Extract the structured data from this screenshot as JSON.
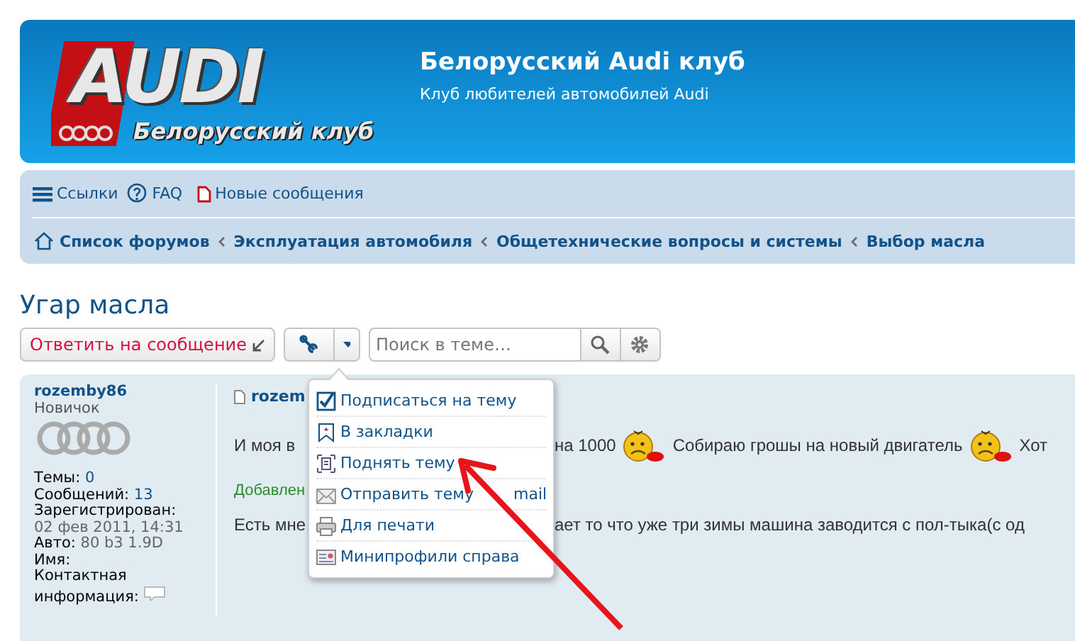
{
  "header": {
    "logo": {
      "word": "AUDI",
      "tagline": "Белорусский клуб"
    },
    "title": "Белорусский Audi клуб",
    "subtitle": "Клуб любителей автомобилей Audi"
  },
  "navbar": {
    "links": [
      {
        "kind": "menu",
        "label": "Ссылки"
      },
      {
        "kind": "faq",
        "label": "FAQ"
      },
      {
        "kind": "new",
        "label": "Новые сообщения"
      }
    ],
    "breadcrumbs": [
      "Список форумов",
      "Эксплуатация автомобиля",
      "Общетехнические вопросы и системы",
      "Выбор масла"
    ]
  },
  "topic": {
    "title": "Угар масла",
    "reply_button": "Ответить на сообщение",
    "search": {
      "placeholder": "Поиск в теме…"
    }
  },
  "post": {
    "author": {
      "name": "rozemby86",
      "rank": "Новичок",
      "fields": [
        {
          "label": "Темы:",
          "value": "0",
          "kind": "link"
        },
        {
          "label": "Сообщений:",
          "value": "13",
          "kind": "link"
        },
        {
          "label": "Зарегистрирован:",
          "value": "02 фев 2011, 14:31",
          "kind": "wrap"
        },
        {
          "label": "Авто:",
          "value": "80 b3 1.9D",
          "kind": "plain"
        },
        {
          "label": "Имя:",
          "kind": "plain"
        },
        {
          "label": "Контактная информация:",
          "kind": "contact"
        }
      ]
    },
    "header_text": "rozem",
    "line1": {
      "left": "И моя в",
      "right": [
        {
          "kind": "text",
          "text": "на 1000"
        },
        {
          "kind": "smiley"
        },
        {
          "kind": "text",
          "text": "Собираю грошы на новый двигатель"
        },
        {
          "kind": "smiley"
        },
        {
          "kind": "text",
          "text": "Хот"
        }
      ]
    },
    "added": "Добавлен",
    "line2": {
      "left": "Есть мне",
      "right": [
        {
          "kind": "text",
          "text": "ает то что уже три зимы машина заводится с пол-тыка(с од"
        }
      ]
    }
  },
  "menu": {
    "items": [
      {
        "kind": "subscribe",
        "label": "Подписаться на тему"
      },
      {
        "kind": "bookmark",
        "label": "В закладки"
      },
      {
        "kind": "bump",
        "label": "Поднять тему"
      },
      {
        "kind": "email",
        "label": "Отправить тему",
        "label_tail": "mail"
      },
      {
        "kind": "print",
        "label": "Для печати"
      },
      {
        "kind": "profile",
        "label": "Минипрофили справа"
      }
    ]
  }
}
